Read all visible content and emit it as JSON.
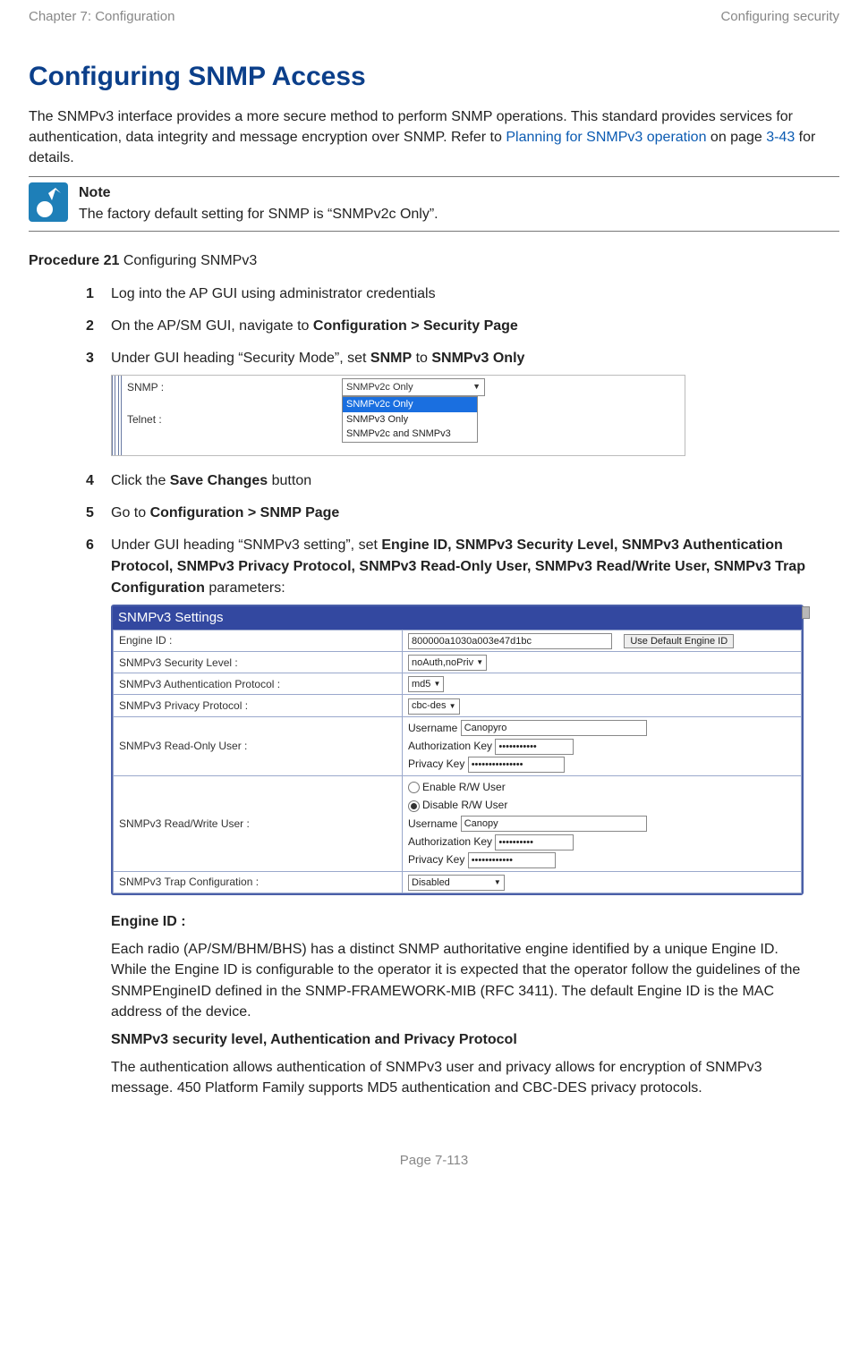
{
  "header": {
    "left": "Chapter 7:  Configuration",
    "right": "Configuring security"
  },
  "h1": "Configuring SNMP Access",
  "intro": {
    "pre": "The SNMPv3 interface provides a more secure method to perform SNMP operations. This standard provides services for authentication, data integrity and message encryption over SNMP. Refer to ",
    "link": "Planning for SNMPv3 operation",
    "mid": " on page ",
    "page_ref": "3-43",
    "post": " for details."
  },
  "note": {
    "head": "Note",
    "body": "The factory default setting for SNMP is “SNMPv2c Only”."
  },
  "procedure": {
    "label": "Procedure 21",
    "title": " Configuring SNMPv3"
  },
  "steps": {
    "s1": "Log into the AP GUI using administrator credentials",
    "s2_pre": "On the AP/SM GUI, navigate to ",
    "s2_bold": "Configuration > Security Page",
    "s3_pre": "Under GUI heading “Security Mode”, set ",
    "s3_b1": "SNMP",
    "s3_mid": " to ",
    "s3_b2": "SNMPv3 Only",
    "s4_pre": "Click the ",
    "s4_bold": "Save Changes",
    "s4_post": " button",
    "s5_pre": "Go to ",
    "s5_bold": "Configuration > SNMP Page",
    "s6_pre": "Under GUI heading “SNMPv3 setting”, set ",
    "s6_bold": "Engine ID, SNMPv3 Security Level, SNMPv3 Authentication Protocol, SNMPv3 Privacy Protocol, SNMPv3 Read-Only User, SNMPv3 Read/Write User, SNMPv3 Trap Configuration",
    "s6_post": " parameters:"
  },
  "shot1": {
    "row1": "SNMP :",
    "row2": "Telnet :",
    "sel_val": "SNMPv2c Only",
    "opts": [
      "SNMPv2c Only",
      "SNMPv3 Only",
      "SNMPv2c and SNMPv3"
    ]
  },
  "shot2": {
    "title": "SNMPv3 Settings",
    "rows": {
      "engine_lbl": "Engine ID :",
      "engine_val": "800000a1030a003e47d1bc",
      "engine_btn": "Use Default Engine ID",
      "seclvl_lbl": "SNMPv3 Security Level :",
      "seclvl_val": "noAuth,noPriv",
      "auth_lbl": "SNMPv3 Authentication Protocol :",
      "auth_val": "md5",
      "priv_lbl": "SNMPv3 Privacy Protocol :",
      "priv_val": "cbc-des",
      "ro_lbl": "SNMPv3 Read-Only User :",
      "ro_user_lbl": "Username",
      "ro_user_val": "Canopyro",
      "ro_auth_lbl": "Authorization Key",
      "ro_auth_val": "•••••••••••",
      "ro_priv_lbl": "Privacy Key",
      "ro_priv_val": "•••••••••••••••",
      "rw_lbl": "SNMPv3 Read/Write User :",
      "rw_enable": "Enable R/W User",
      "rw_disable": "Disable R/W User",
      "rw_user_lbl": "Username",
      "rw_user_val": "Canopy",
      "rw_auth_lbl": "Authorization Key",
      "rw_auth_val": "••••••••••",
      "rw_priv_lbl": "Privacy Key",
      "rw_priv_val": "••••••••••••",
      "trap_lbl": "SNMPv3 Trap Configuration :",
      "trap_val": "Disabled"
    }
  },
  "explain": {
    "engine_head": "Engine ID :",
    "engine_body": "Each radio (AP/SM/BHM/BHS) has a distinct SNMP authoritative engine identified by a unique Engine ID. While the Engine ID is configurable to the operator it is expected that the operator follow the guidelines of the SNMPEngineID defined in the SNMP-FRAMEWORK-MIB (RFC 3411). The default Engine ID is the MAC address of the device.",
    "sec_head": "SNMPv3 security level, Authentication and Privacy Protocol",
    "sec_body": "The authentication allows authentication of SNMPv3 user and privacy allows for encryption of SNMPv3 message. 450 Platform Family supports MD5 authentication and CBC-DES privacy protocols."
  },
  "footer": "Page 7-113"
}
